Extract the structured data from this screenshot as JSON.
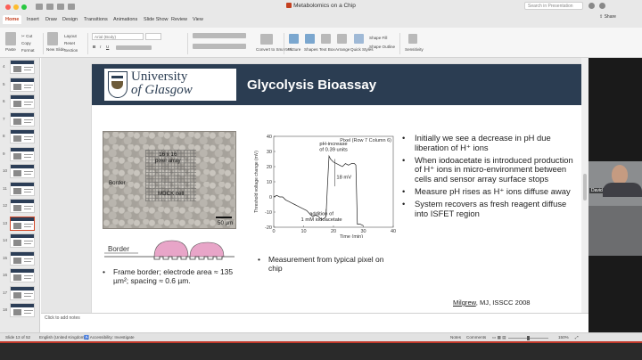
{
  "window": {
    "title": "Metabolomics on a Chip",
    "search_placeholder": "Search in Presentation",
    "share_label": "Share"
  },
  "tabs": [
    "Home",
    "Insert",
    "Draw",
    "Design",
    "Transitions",
    "Animations",
    "Slide Show",
    "Review",
    "View"
  ],
  "ribbon": {
    "cut": "Cut",
    "copy": "Copy",
    "format": "Format",
    "paste": "Paste",
    "new_slide": "New Slide",
    "layout": "Layout",
    "reset": "Reset",
    "section": "Section",
    "font_value": "Arial (Body)",
    "convert_smartart": "Convert to SmartArt",
    "picture": "Picture",
    "shapes": "Shapes",
    "text_box": "Text Box",
    "arrange": "Arrange",
    "quick_styles": "Quick Styles",
    "shape_fill": "Shape Fill",
    "shape_outline": "Shape Outline",
    "sensitivity": "Sensitivity"
  },
  "thumbnails": [
    "4",
    "5",
    "6",
    "7",
    "8",
    "9",
    "10",
    "11",
    "12",
    "13",
    "14",
    "15",
    "16",
    "17",
    "18"
  ],
  "selected_thumbnail": "13",
  "slide": {
    "university_line1": "University",
    "university_line2": "of Glasgow",
    "title": "Glycolysis Bioassay",
    "micro": {
      "array_label": "16 x 16\npixel array",
      "border_label": "Border",
      "cell_label": "MDCK cell",
      "scale_label": "50 µm"
    },
    "diagram_label": "Border",
    "left_bullet": "Frame border; electrode area ≈ 135 µm²; spacing ≈ 0.6 µm.",
    "mid_bullet": "Measurement from typical pixel on chip",
    "right_bullets": [
      "Initially we see a decrease in pH due liberation of H⁺ ions",
      "When iodoacetate is introduced production of H⁺ ions in micro-environment between cells and sensor array surface stops",
      "Measure pH rises as H⁺ ions diffuse away",
      "System recovers as fresh reagent diffuse into ISFET region"
    ],
    "citation_author": "Milgrew",
    "citation_rest": ", MJ, ISSCC 2008"
  },
  "chart_data": {
    "type": "line",
    "title": "Pixel (Row 7 Column 6)",
    "xlabel": "Time (min)",
    "ylabel": "Threshold voltage change (mV)",
    "xlim": [
      0,
      40
    ],
    "ylim": [
      -20,
      40
    ],
    "xticks": [
      0,
      10,
      20,
      30,
      40
    ],
    "yticks": [
      -20,
      -10,
      0,
      10,
      20,
      30,
      40
    ],
    "annotations": {
      "increase": "pH-increase\nof 0.39 units",
      "delta": "18 mV",
      "addition": "addition of\n1 mM iodoacetate"
    },
    "series": [
      {
        "x": [
          0,
          1,
          2,
          3,
          4,
          5,
          6,
          7,
          8,
          9,
          10,
          11,
          12,
          13,
          14,
          15,
          15.5,
          16,
          17,
          17.5,
          18,
          18.5,
          19,
          20,
          21,
          22,
          23,
          24,
          25,
          26,
          27,
          27.5,
          28,
          29,
          30
        ],
        "y": [
          0,
          1,
          0,
          0,
          -2,
          -3,
          -4,
          -5,
          -6,
          -7,
          -8,
          -9,
          -11,
          -13,
          -12,
          -13,
          -14,
          -15,
          -14,
          -13,
          8,
          27,
          25,
          23,
          22,
          21,
          20,
          22,
          21,
          22,
          22,
          21,
          -18,
          -18,
          -19
        ]
      }
    ]
  },
  "notes_placeholder": "Click to add notes",
  "participant_name": "David Cumming",
  "status": {
    "slide_info": "Slide 13 of 52",
    "language": "English (United Kingdom)",
    "accessibility": "Accessibility: Investigate",
    "notes": "Notes",
    "comments": "Comments",
    "zoom": "150%"
  }
}
